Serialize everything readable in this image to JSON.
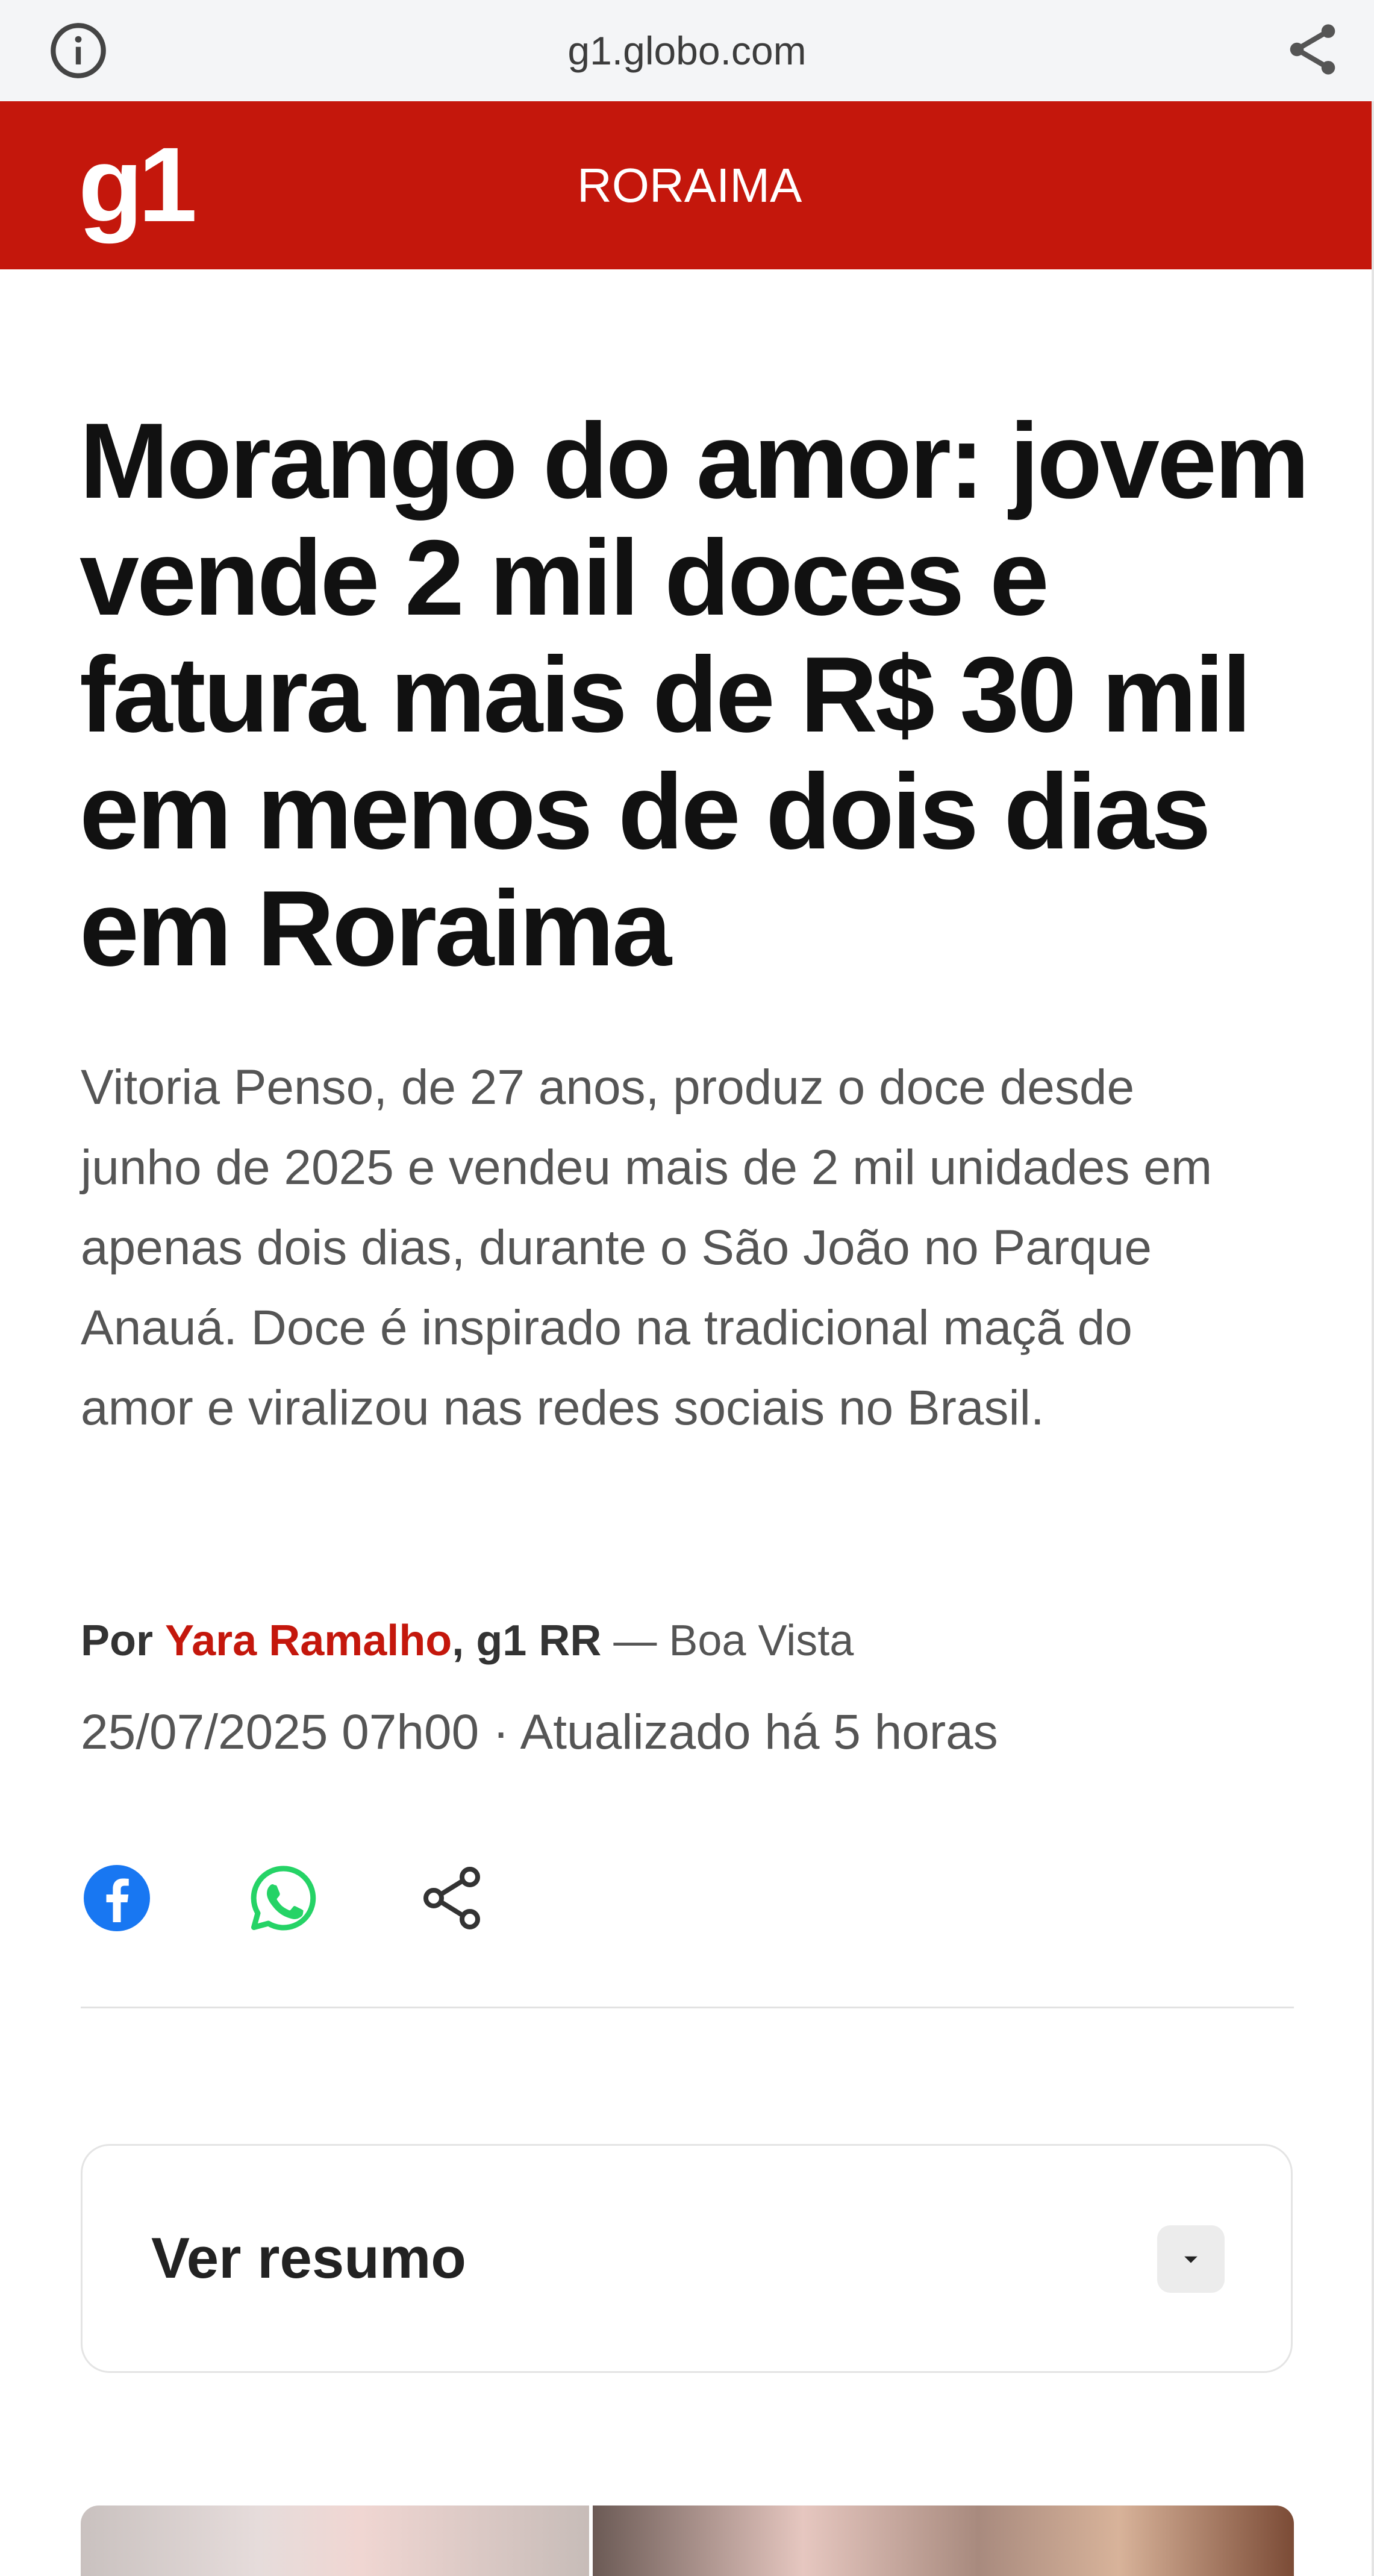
{
  "browser": {
    "url": "g1.globo.com",
    "info_icon": "info-icon",
    "share_icon": "share-icon"
  },
  "header": {
    "logo": "g1",
    "section": "RORAIMA",
    "brand_color": "#c4170c"
  },
  "article": {
    "headline": "Morango do amor: jovem vende 2 mil doces e fatura mais de R$ 30 mil em menos de dois dias em Roraima",
    "subtitle": "Vitoria Penso, de 27 anos, produz o doce desde junho de 2025 e vendeu mais de 2 mil unidades em apenas dois dias, durante o São João no Parque Anauá. Doce é inspirado na tradicional maçã do amor e viralizou nas redes sociais no Brasil.",
    "byline": {
      "prefix": "Por",
      "author": "Yara Ramalho",
      "separator": ",",
      "outlet": "g1 RR",
      "location": "— Boa Vista"
    },
    "dateline": "25/07/2025 07h00 · Atualizado há 5 horas"
  },
  "share": {
    "facebook_icon": "facebook-icon",
    "whatsapp_icon": "whatsapp-icon",
    "share_icon": "share-icon",
    "facebook_color": "#1877f2",
    "whatsapp_color": "#25d366"
  },
  "summary": {
    "label": "Ver resumo"
  }
}
